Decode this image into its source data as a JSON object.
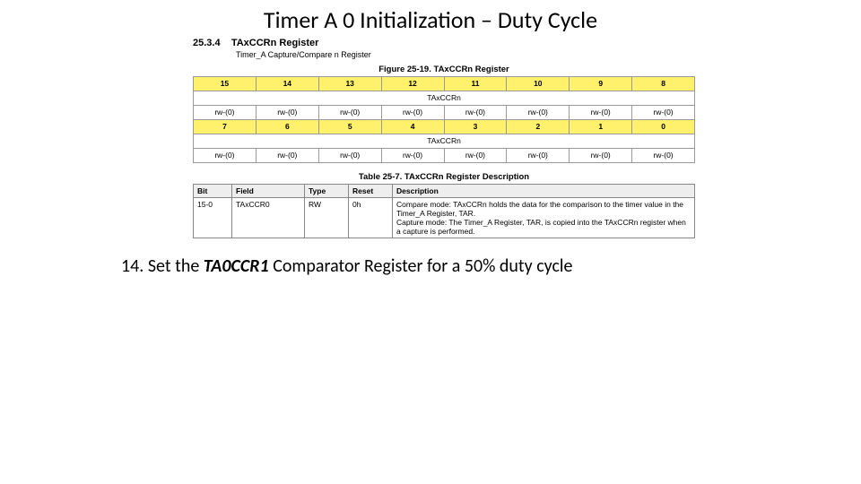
{
  "title": "Timer A 0 Initialization – Duty Cycle",
  "section": {
    "number": "25.3.4",
    "heading": "TAxCCRn Register",
    "sub": "Timer_A Capture/Compare n Register"
  },
  "figure": {
    "caption": "Figure 25-19. TAxCCRn Register",
    "row1_bits": [
      "15",
      "14",
      "13",
      "12",
      "11",
      "10",
      "9",
      "8"
    ],
    "row1_label": "TAxCCRn",
    "row1_vals": [
      "rw-(0)",
      "rw-(0)",
      "rw-(0)",
      "rw-(0)",
      "rw-(0)",
      "rw-(0)",
      "rw-(0)",
      "rw-(0)"
    ],
    "row2_bits": [
      "7",
      "6",
      "5",
      "4",
      "3",
      "2",
      "1",
      "0"
    ],
    "row2_label": "TAxCCRn",
    "row2_vals": [
      "rw-(0)",
      "rw-(0)",
      "rw-(0)",
      "rw-(0)",
      "rw-(0)",
      "rw-(0)",
      "rw-(0)",
      "rw-(0)"
    ]
  },
  "desc_table": {
    "caption": "Table 25-7. TAxCCRn Register Description",
    "headers": [
      "Bit",
      "Field",
      "Type",
      "Reset",
      "Description"
    ],
    "row": {
      "bit": "15-0",
      "field": "TAxCCR0",
      "type": "RW",
      "reset": "0h",
      "desc_line1": "Compare mode: TAxCCRn holds the data for the comparison to the timer value in the Timer_A Register, TAR.",
      "desc_line2": "Capture mode: The Timer_A Register, TAR, is copied into the TAxCCRn register when a capture is performed."
    }
  },
  "instruction": {
    "num": "14.",
    "before": "Set the ",
    "reg": "TA0CCR1",
    "after": "  Comparator Register for a 50% duty cycle"
  }
}
